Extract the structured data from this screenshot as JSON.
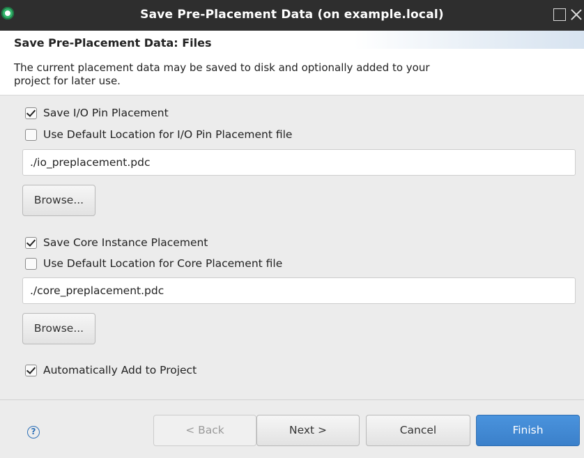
{
  "window": {
    "title": "Save Pre-Placement Data  (on example.local)"
  },
  "header": {
    "page_title": "Save Pre-Placement Data: Files",
    "description": "The current placement data may be saved to disk and optionally added to your project for later use."
  },
  "io_section": {
    "save_checkbox": {
      "label": "Save I/O Pin Placement",
      "checked": true
    },
    "default_location_checkbox": {
      "label": "Use Default Location for I/O Pin Placement file",
      "checked": false
    },
    "path_value": "./io_preplacement.pdc",
    "browse_label": "Browse..."
  },
  "core_section": {
    "save_checkbox": {
      "label": "Save Core Instance Placement",
      "checked": true
    },
    "default_location_checkbox": {
      "label": "Use Default Location for Core Placement file",
      "checked": false
    },
    "path_value": "./core_preplacement.pdc",
    "browse_label": "Browse..."
  },
  "auto_add": {
    "label": "Automatically Add to Project",
    "checked": true
  },
  "footer": {
    "help_glyph": "?",
    "back_label": "< Back",
    "next_label": "Next >",
    "cancel_label": "Cancel",
    "finish_label": "Finish"
  },
  "colors": {
    "title_bar": "#2e2e2e",
    "finish_button": "#3b80ca",
    "help_icon": "#2c6fb7"
  }
}
